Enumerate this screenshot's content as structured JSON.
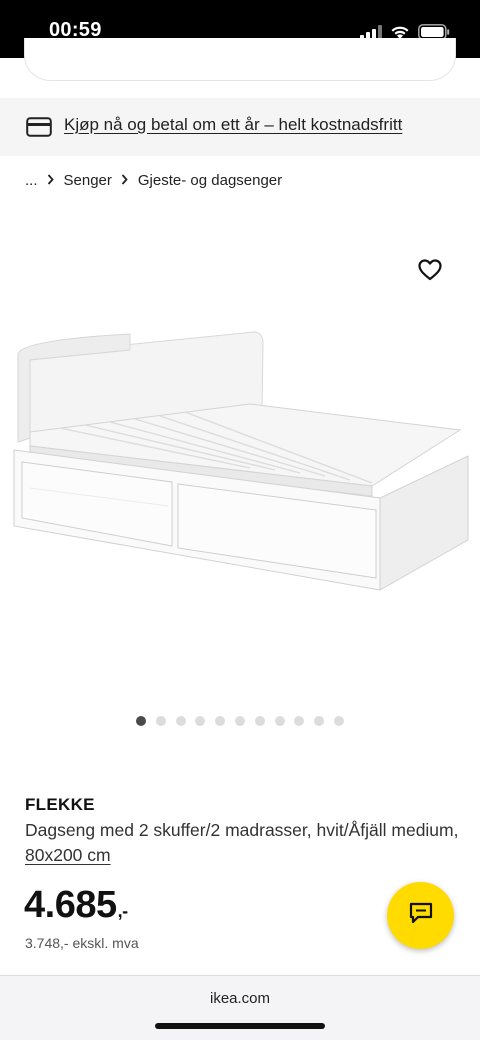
{
  "status": {
    "time": "00:59"
  },
  "promo": {
    "text": "Kjøp nå og betal om ett år – helt kostnadsfritt",
    "icon": "credit-card-icon"
  },
  "breadcrumb": {
    "items": [
      "...",
      "Senger",
      "Gjeste- og dagsenger"
    ]
  },
  "gallery": {
    "total_images": 11,
    "active_index": 0
  },
  "product": {
    "name": "FLEKKE",
    "description": "Dagseng med 2 skuffer/2 madrasser, hvit/Åfjäll medium,",
    "size": "80x200 cm",
    "price": "4.685",
    "price_suffix": ",-",
    "price_ex_vat": "3.748,- ekskl. mva"
  },
  "browser": {
    "url": "ikea.com"
  },
  "colors": {
    "chat_button": "#ffdb00",
    "promo_bg": "#f5f5f5",
    "status_bg": "#000000"
  }
}
